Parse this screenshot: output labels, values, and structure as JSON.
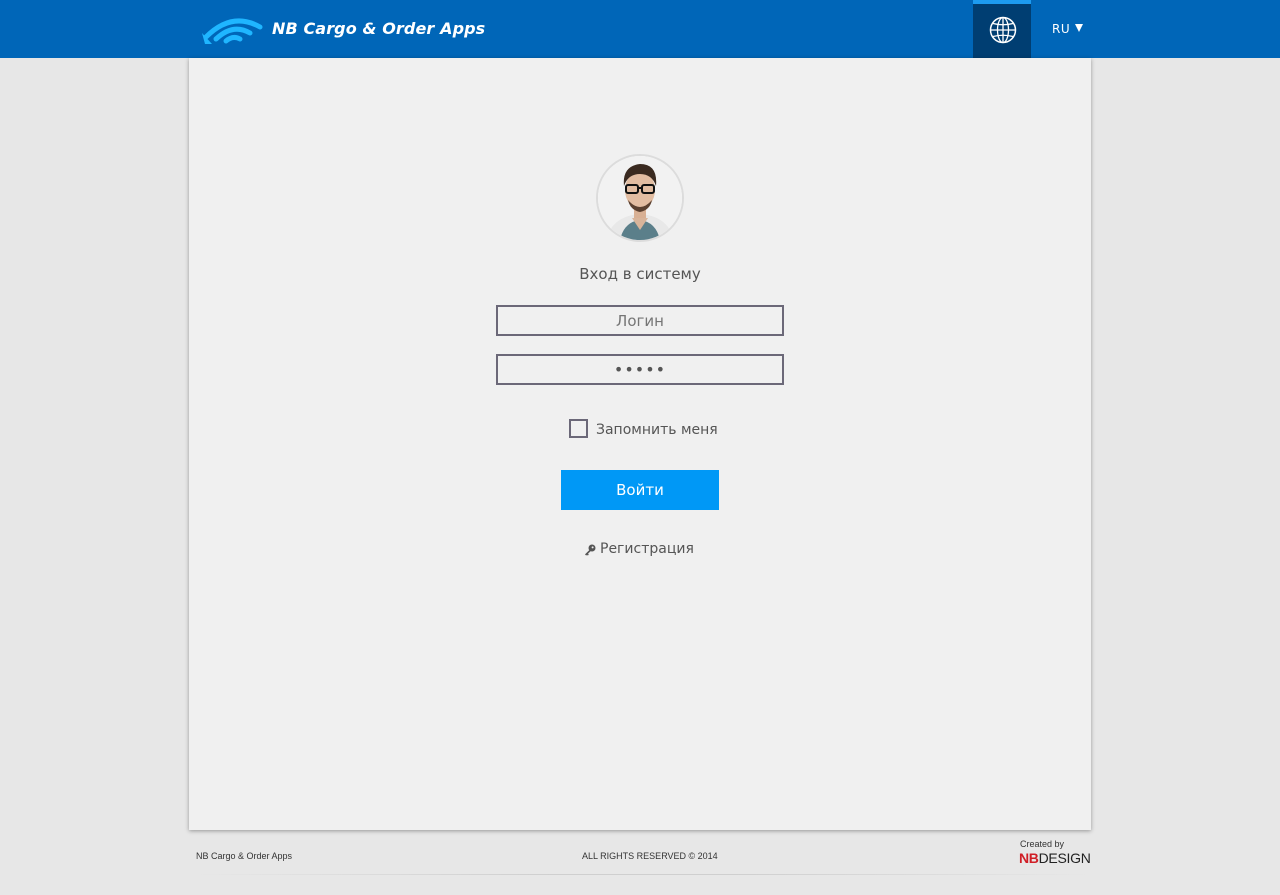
{
  "header": {
    "app_title": "NB Cargo & Order Apps",
    "logo_icon": "wifi-arrow-logo",
    "globe_icon": "globe-icon",
    "language": "RU",
    "brand_color": "#0066b8",
    "accent_color": "#0098f6"
  },
  "login": {
    "title": "Вход в систему",
    "login_placeholder": "Логин",
    "password_value": "•••••",
    "remember_label": "Запомнить меня",
    "remember_checked": false,
    "submit_label": "Войти",
    "register_label": "Регистрация",
    "register_icon": "key-icon"
  },
  "footer": {
    "left": "NB Cargo & Order Apps",
    "center": "ALL RIGHTS RESERVED © 2014",
    "created_by": "Created by",
    "brand_nb": "NB",
    "brand_design": "DESIGN"
  }
}
